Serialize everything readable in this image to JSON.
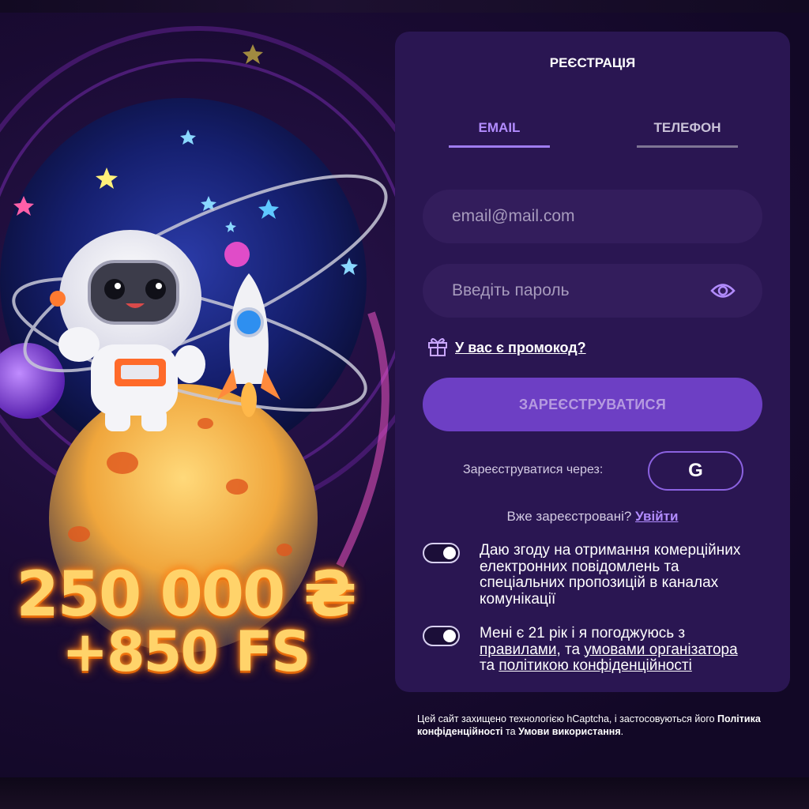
{
  "form": {
    "title": "РЕЄСТРАЦІЯ",
    "tabs": [
      {
        "label": "EMAIL",
        "active": true
      },
      {
        "label": "ТЕЛЕФОН",
        "active": false
      }
    ],
    "email_placeholder": "email@mail.com",
    "password_placeholder": "Введіть пароль",
    "promo_link": "У вас є промокод?",
    "register_button": "ЗАРЕЄСТРУВАТИСЯ",
    "register_via_label": "Зареєструватися через:",
    "google_button": "G",
    "already_registered": "Вже зареєстровані?",
    "login_link": "Увійти",
    "consent_marketing": "Даю згоду на отримання комерційних електронних повідомлень та спеціальних пропозицій в каналах комунікації",
    "consent_terms": {
      "prefix": "Мені є 21 рік і я погоджуюсь з",
      "rules": "правилами",
      "sep1": ", та",
      "organizer_terms": "умовами організатора",
      "sep2": "та",
      "privacy": "політикою конфіденційності"
    }
  },
  "promo": {
    "amount": "250 000 ₴",
    "free_spins": "+850 FS"
  },
  "captcha_note": {
    "text": "Цей сайт захищено технологією hCaptcha, і застосовуються його",
    "privacy": "Політика конфіденційності",
    "and": "та",
    "terms": "Умови використання",
    "end": "."
  },
  "colors": {
    "panel": "#2a1652",
    "accent": "#b28cff",
    "button": "#6d3fc4"
  }
}
